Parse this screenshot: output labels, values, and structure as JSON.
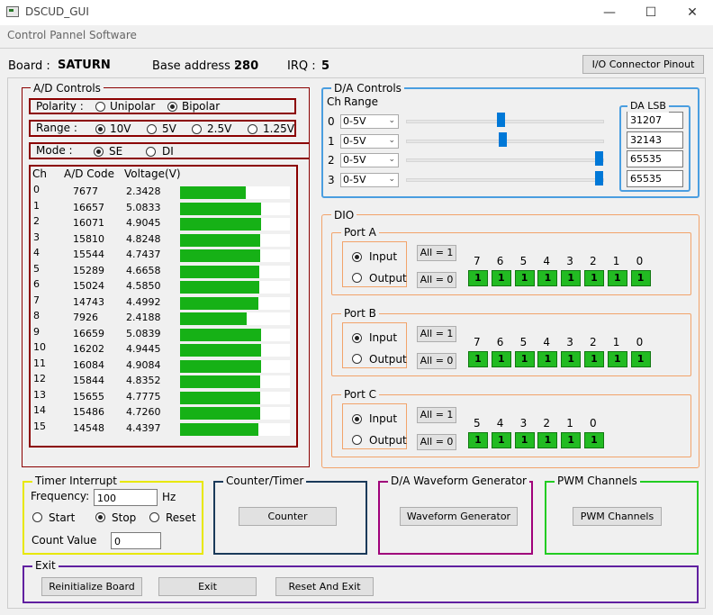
{
  "window": {
    "title": "DSCUD_GUI",
    "subtitle": "Control Pannel Software",
    "minimize": "—",
    "maximize": "☐",
    "close": "✕"
  },
  "board": {
    "board_label": "Board :",
    "board_value": "SATURN",
    "base_label": "Base address :",
    "base_value": "280",
    "irq_label": "IRQ :",
    "irq_value": "5",
    "pinout_button": "I/O Connector Pinout"
  },
  "ad": {
    "title": "A/D Controls",
    "polarity_label": "Polarity  :",
    "polarity_options": [
      "Unipolar",
      "Bipolar"
    ],
    "polarity_selected": "Bipolar",
    "range_label": "Range   :",
    "range_options": [
      "10V",
      "5V",
      "2.5V",
      "1.25V"
    ],
    "range_selected": "10V",
    "mode_label": "Mode   :",
    "mode_options": [
      "SE",
      "DI"
    ],
    "mode_selected": "SE",
    "headers": [
      "Ch",
      "A/D Code",
      "Voltage(V)"
    ],
    "rows": [
      {
        "ch": "0",
        "code": "7677",
        "volt": "2.3428",
        "level": 0.6
      },
      {
        "ch": "1",
        "code": "16657",
        "volt": "5.0833",
        "level": 0.74
      },
      {
        "ch": "2",
        "code": "16071",
        "volt": "4.9045",
        "level": 0.74
      },
      {
        "ch": "3",
        "code": "15810",
        "volt": "4.8248",
        "level": 0.73
      },
      {
        "ch": "4",
        "code": "15544",
        "volt": "4.7437",
        "level": 0.73
      },
      {
        "ch": "5",
        "code": "15289",
        "volt": "4.6658",
        "level": 0.72
      },
      {
        "ch": "6",
        "code": "15024",
        "volt": "4.5850",
        "level": 0.72
      },
      {
        "ch": "7",
        "code": "14743",
        "volt": "4.4992",
        "level": 0.71
      },
      {
        "ch": "8",
        "code": "7926",
        "volt": "2.4188",
        "level": 0.61
      },
      {
        "ch": "9",
        "code": "16659",
        "volt": "5.0839",
        "level": 0.74
      },
      {
        "ch": "10",
        "code": "16202",
        "volt": "4.9445",
        "level": 0.74
      },
      {
        "ch": "11",
        "code": "16084",
        "volt": "4.9084",
        "level": 0.74
      },
      {
        "ch": "12",
        "code": "15844",
        "volt": "4.8352",
        "level": 0.73
      },
      {
        "ch": "13",
        "code": "15655",
        "volt": "4.7775",
        "level": 0.73
      },
      {
        "ch": "14",
        "code": "15486",
        "volt": "4.7260",
        "level": 0.73
      },
      {
        "ch": "15",
        "code": "14548",
        "volt": "4.4397",
        "level": 0.71
      }
    ]
  },
  "da": {
    "title": "D/A Controls",
    "ch_header": "Ch",
    "range_header": "Range",
    "lsb_title": "DA LSB",
    "channels": [
      {
        "ch": "0",
        "range": "0-5V",
        "slider": 0.48,
        "lsb": "31207"
      },
      {
        "ch": "1",
        "range": "0-5V",
        "slider": 0.49,
        "lsb": "32143"
      },
      {
        "ch": "2",
        "range": "0-5V",
        "slider": 1.0,
        "lsb": "65535"
      },
      {
        "ch": "3",
        "range": "0-5V",
        "slider": 1.0,
        "lsb": "65535"
      }
    ]
  },
  "dio": {
    "title": "DIO",
    "input_label": "Input",
    "output_label": "Output",
    "all1": "All = 1",
    "all0": "All = 0",
    "ports": [
      {
        "name": "Port A",
        "mode": "Input",
        "bits": [
          "7",
          "6",
          "5",
          "4",
          "3",
          "2",
          "1",
          "0"
        ],
        "values": [
          "1",
          "1",
          "1",
          "1",
          "1",
          "1",
          "1",
          "1"
        ]
      },
      {
        "name": "Port B",
        "mode": "Input",
        "bits": [
          "7",
          "6",
          "5",
          "4",
          "3",
          "2",
          "1",
          "0"
        ],
        "values": [
          "1",
          "1",
          "1",
          "1",
          "1",
          "1",
          "1",
          "1"
        ]
      },
      {
        "name": "Port C",
        "mode": "Input",
        "bits": [
          "5",
          "4",
          "3",
          "2",
          "1",
          "0"
        ],
        "values": [
          "1",
          "1",
          "1",
          "1",
          "1",
          "1"
        ]
      }
    ]
  },
  "timer": {
    "title": "Timer Interrupt",
    "freq_label": "Frequency:",
    "freq_value": "100",
    "freq_unit": "Hz",
    "start": "Start",
    "stop": "Stop",
    "reset": "Reset",
    "selected": "Stop",
    "count_label": "Count Value",
    "count_value": "0"
  },
  "counter": {
    "title": "Counter/Timer",
    "button": "Counter"
  },
  "waveform": {
    "title": "D/A Waveform Generator",
    "button": "Waveform Generator"
  },
  "pwm": {
    "title": "PWM Channels",
    "button": "PWM Channels"
  },
  "exit": {
    "title": "Exit",
    "reinit": "Reinitialize Board",
    "exit": "Exit",
    "reset_exit": "Reset And Exit"
  },
  "colors": {
    "ad": "#8b0000",
    "da": "#4a9ee0",
    "dio": "#f2a36a",
    "timer": "#e8e800",
    "counter": "#1a3a5a",
    "waveform": "#a0007a",
    "pwm": "#22cc22",
    "exit": "#6020a0",
    "bit_on": "#22bb22"
  }
}
